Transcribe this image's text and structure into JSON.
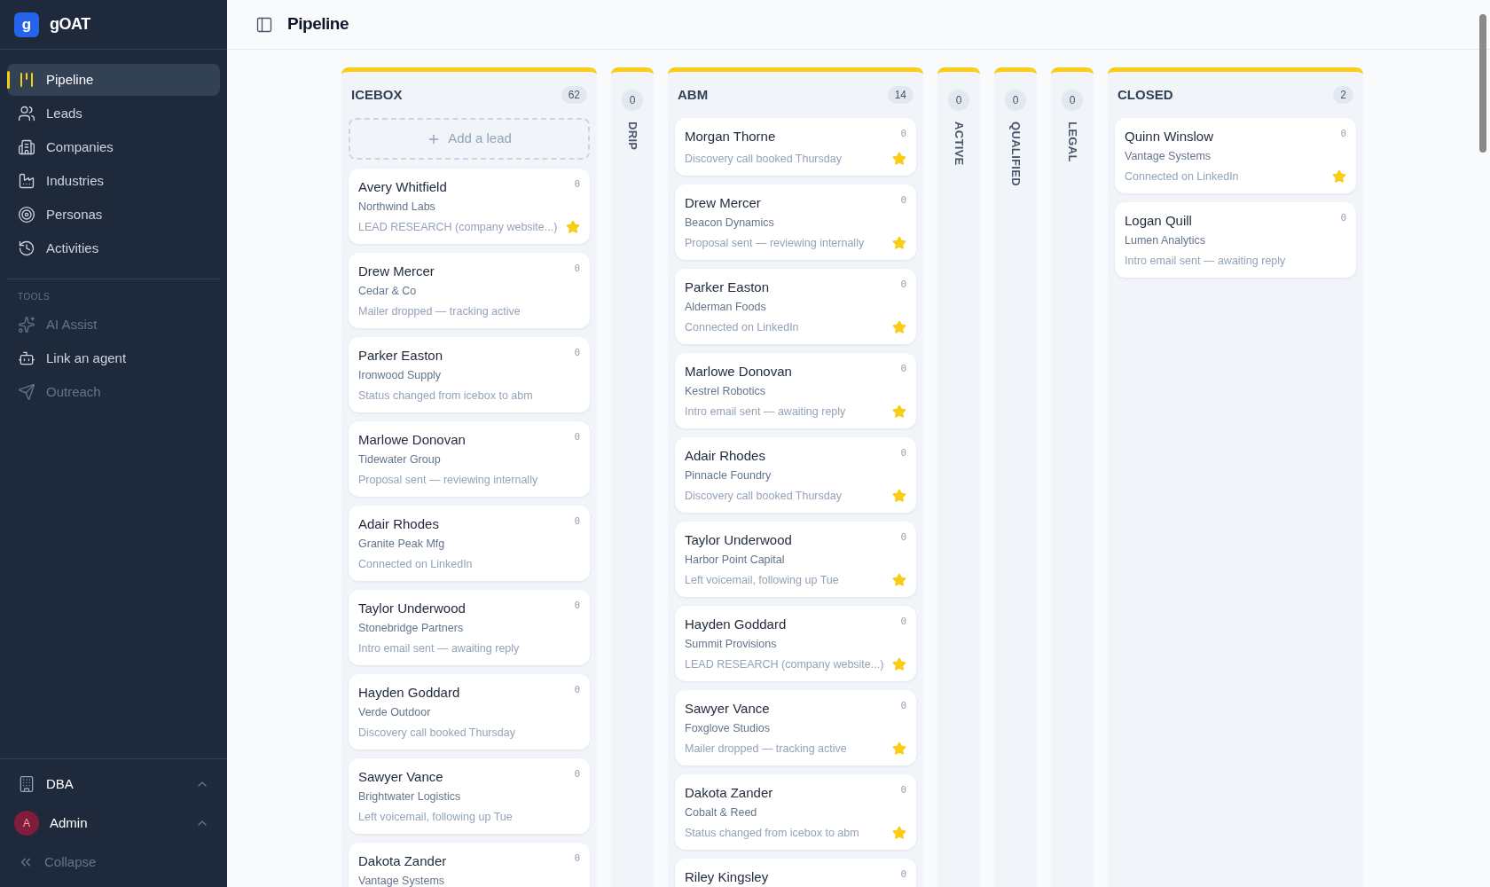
{
  "app": {
    "logo_letter": "g",
    "name": "gOAT"
  },
  "sidebar": {
    "items": [
      {
        "label": "Pipeline",
        "selected": true
      },
      {
        "label": "Leads",
        "selected": false
      },
      {
        "label": "Companies",
        "selected": false
      },
      {
        "label": "Industries",
        "selected": false
      },
      {
        "label": "Personas",
        "selected": false
      },
      {
        "label": "Activities",
        "selected": false
      }
    ],
    "tools_heading": "TOOLS",
    "tools": [
      {
        "label": "AI Assist",
        "disabled": true
      },
      {
        "label": "Link an agent",
        "disabled": false
      },
      {
        "label": "Outreach",
        "disabled": true
      }
    ],
    "workspace": {
      "label": "DBA"
    },
    "user": {
      "initial": "A",
      "name": "Admin"
    },
    "collapse": "Collapse"
  },
  "header": {
    "title": "Pipeline"
  },
  "columns": [
    {
      "title": "ICEBOX",
      "count": "62",
      "expanded": true,
      "add_label": "Add a lead",
      "cards": [
        {
          "name": "Avery Whitfield",
          "company": "Northwind Labs",
          "note": "LEAD RESEARCH (company website...)",
          "count": "0",
          "starred": true
        },
        {
          "name": "Drew Mercer",
          "company": "Cedar & Co",
          "note": "Mailer dropped — tracking active",
          "count": "0",
          "starred": false
        },
        {
          "name": "Parker Easton",
          "company": "Ironwood Supply",
          "note": "Status changed from icebox to abm",
          "count": "0",
          "starred": false
        },
        {
          "name": "Marlowe Donovan",
          "company": "Tidewater Group",
          "note": "Proposal sent — reviewing internally",
          "count": "0",
          "starred": false
        },
        {
          "name": "Adair Rhodes",
          "company": "Granite Peak Mfg",
          "note": "Connected on LinkedIn",
          "count": "0",
          "starred": false
        },
        {
          "name": "Taylor Underwood",
          "company": "Stonebridge Partners",
          "note": "Intro email sent — awaiting reply",
          "count": "0",
          "starred": false
        },
        {
          "name": "Hayden Goddard",
          "company": "Verde Outdoor",
          "note": "Discovery call booked Thursday",
          "count": "0",
          "starred": false
        },
        {
          "name": "Sawyer Vance",
          "company": "Brightwater Logistics",
          "note": "Left voicemail, following up Tue",
          "count": "0",
          "starred": false
        },
        {
          "name": "Dakota Zander",
          "company": "Vantage Systems",
          "count": "0"
        }
      ]
    },
    {
      "title": "DRIP",
      "count": "0",
      "expanded": false
    },
    {
      "title": "ABM",
      "count": "14",
      "expanded": true,
      "cards": [
        {
          "name": "Morgan Thorne",
          "note": "Discovery call booked Thursday",
          "count": "0",
          "starred": true
        },
        {
          "name": "Drew Mercer",
          "company": "Beacon Dynamics",
          "note": "Proposal sent — reviewing internally",
          "count": "0",
          "starred": true
        },
        {
          "name": "Parker Easton",
          "company": "Alderman Foods",
          "note": "Connected on LinkedIn",
          "count": "0",
          "starred": true
        },
        {
          "name": "Marlowe Donovan",
          "company": "Kestrel Robotics",
          "note": "Intro email sent — awaiting reply",
          "count": "0",
          "starred": true
        },
        {
          "name": "Adair Rhodes",
          "company": "Pinnacle Foundry",
          "note": "Discovery call booked Thursday",
          "count": "0",
          "starred": true
        },
        {
          "name": "Taylor Underwood",
          "company": "Harbor Point Capital",
          "note": "Left voicemail, following up Tue",
          "count": "0",
          "starred": true
        },
        {
          "name": "Hayden Goddard",
          "company": "Summit Provisions",
          "note": "LEAD RESEARCH (company website...)",
          "count": "0",
          "starred": true
        },
        {
          "name": "Sawyer Vance",
          "company": "Foxglove Studios",
          "note": "Mailer dropped — tracking active",
          "count": "0",
          "starred": true
        },
        {
          "name": "Dakota Zander",
          "company": "Cobalt & Reed",
          "note": "Status changed from icebox to abm",
          "count": "0",
          "starred": true
        },
        {
          "name": "Riley Kingsley",
          "count": "0"
        }
      ]
    },
    {
      "title": "ACTIVE",
      "count": "0",
      "expanded": false
    },
    {
      "title": "QUALIFIED",
      "count": "0",
      "expanded": false
    },
    {
      "title": "LEGAL",
      "count": "0",
      "expanded": false
    },
    {
      "title": "CLOSED",
      "count": "2",
      "expanded": true,
      "cards": [
        {
          "name": "Quinn Winslow",
          "company": "Vantage Systems",
          "note": "Connected on LinkedIn",
          "count": "0",
          "starred": true
        },
        {
          "name": "Logan Quill",
          "company": "Lumen Analytics",
          "note": "Intro email sent — awaiting reply",
          "count": "0",
          "starred": false
        }
      ]
    }
  ]
}
